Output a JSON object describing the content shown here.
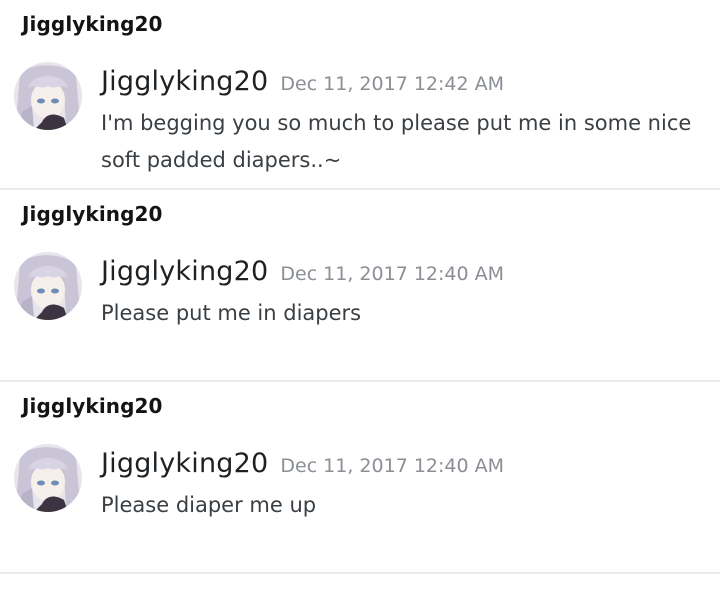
{
  "messages": [
    {
      "group_title": "Jigglyking20",
      "author": "Jigglyking20",
      "timestamp": "Dec 11, 2017 12:42 AM",
      "text": "I'm begging you so much to please put me in some nice soft padded diapers..~"
    },
    {
      "group_title": "Jigglyking20",
      "author": "Jigglyking20",
      "timestamp": "Dec 11, 2017 12:40 AM",
      "text": "Please put me in diapers"
    },
    {
      "group_title": "Jigglyking20",
      "author": "Jigglyking20",
      "timestamp": "Dec 11, 2017 12:40 AM",
      "text": "Please diaper me up"
    }
  ],
  "colors": {
    "background": "#ffffff",
    "divider": "#ececec",
    "username": "#1e2124",
    "timestamp": "#8b8f95",
    "message_text": "#3a3f44"
  },
  "icons": {
    "avatar": "anime-avatar-icon"
  }
}
